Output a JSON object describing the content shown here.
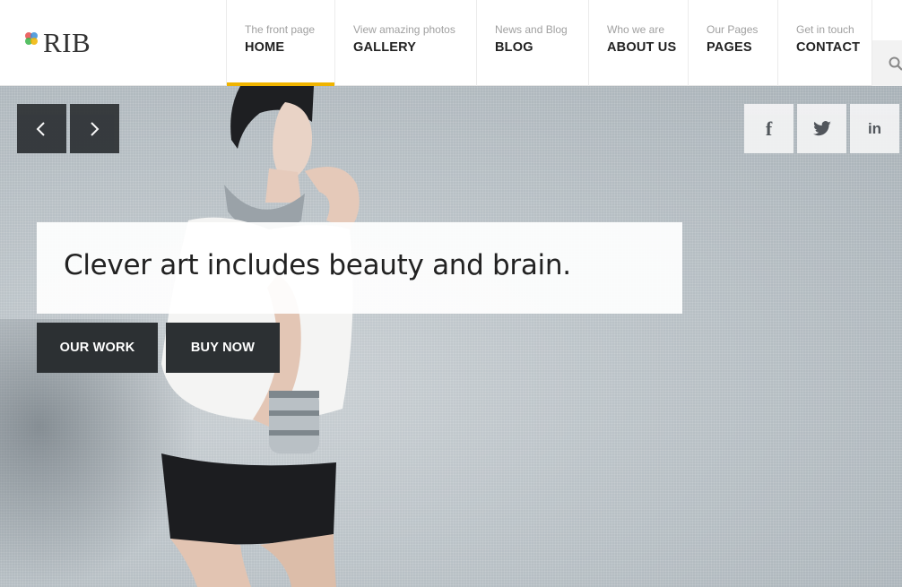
{
  "brand": {
    "name": "RIB",
    "dot_colors": [
      "#e84b4b",
      "#f0b400",
      "#3ab54a",
      "#3a8fd8"
    ]
  },
  "nav": {
    "items": [
      {
        "sub": "The front page",
        "label": "HOME",
        "active": true
      },
      {
        "sub": "View amazing photos",
        "label": "GALLERY",
        "active": false
      },
      {
        "sub": "News and Blog",
        "label": "BLOG",
        "active": false
      },
      {
        "sub": "Who we are",
        "label": "ABOUT US",
        "active": false
      },
      {
        "sub": "Our Pages",
        "label": "PAGES",
        "active": false
      },
      {
        "sub": "Get in touch",
        "label": "CONTACT",
        "active": false
      }
    ],
    "active_color": "#f0b400",
    "search_icon": "search-icon"
  },
  "hero": {
    "tagline": "Clever art includes beauty and brain.",
    "prev_icon": "chevron-left-icon",
    "next_icon": "chevron-right-icon",
    "buttons": {
      "work": "OUR WORK",
      "buy": "BUY NOW"
    },
    "social": {
      "facebook": "f",
      "twitter": "twitter-icon",
      "linkedin": "in"
    }
  }
}
